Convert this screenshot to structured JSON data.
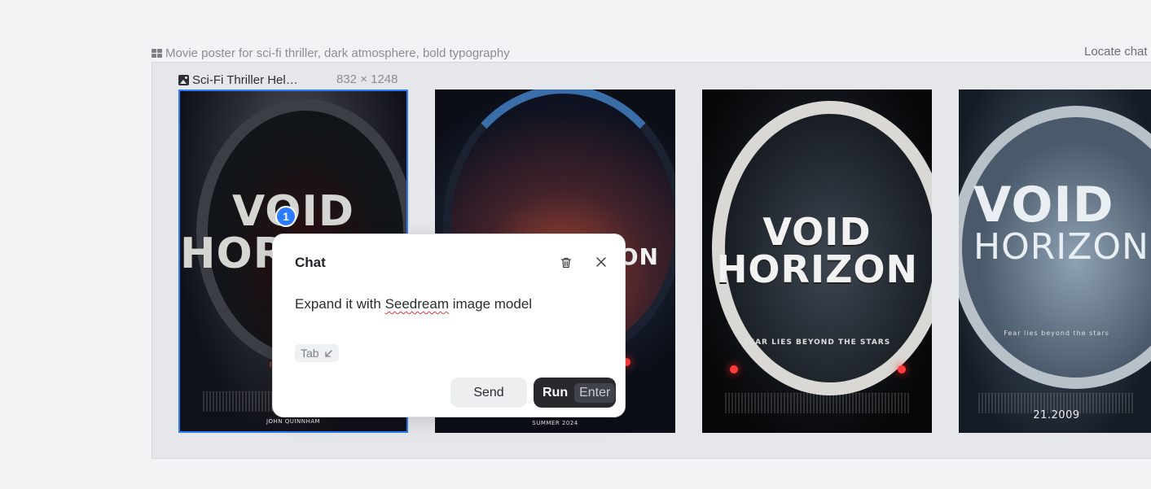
{
  "group": {
    "title": "Movie poster for sci-fi thriller, dark atmosphere, bold typography",
    "icon": "grid-icon"
  },
  "locate_label": "Locate chat",
  "selected_image": {
    "name": "Sci-Fi Thriller Hel…",
    "dimensions": "832 × 1248",
    "icon": "image-icon"
  },
  "posters": [
    {
      "title_line1": "VOID",
      "title_line2": "HORIZON",
      "tagline": "FEAR LIES",
      "footer": "JOHN QUINNHAM"
    },
    {
      "title_line1": "",
      "title_line2": "ON",
      "tagline": "",
      "footer": "SUMMER 2024"
    },
    {
      "title_line1": "VOID",
      "title_line2": "HORIZON",
      "tagline": "FEAR LIES BEYOND THE STARS",
      "footer": ""
    },
    {
      "title_line1": "VOID",
      "title_line2": "HORIZON",
      "tagline": "Fear lies beyond the stars",
      "footer": "21.2009"
    }
  ],
  "badge": "1",
  "chat": {
    "title": "Chat",
    "message_before": "Expand it with ",
    "message_misspelled": "Seedream",
    "message_after": " image model",
    "tab_hint": "Tab",
    "send_label": "Send",
    "run_label": "Run",
    "run_shortcut": "Enter",
    "delete_icon": "trash-icon",
    "close_icon": "close-icon"
  },
  "colors": {
    "accent": "#2b7cff",
    "run_button": "#27292d",
    "background": "#f2f3f5"
  }
}
